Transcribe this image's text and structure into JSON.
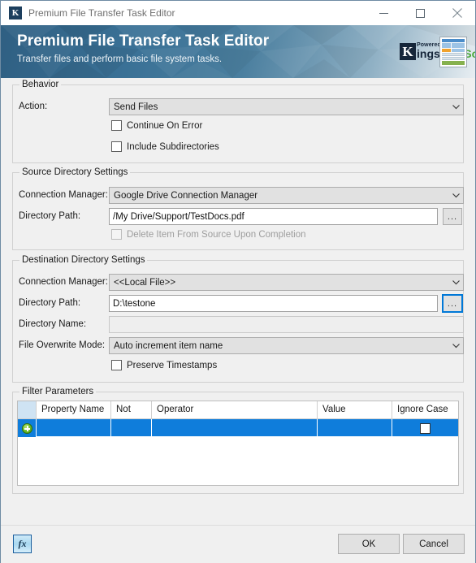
{
  "window": {
    "title": "Premium File Transfer Task Editor",
    "icon": "kingswaysoft-k-icon",
    "controls": {
      "minimize": "minimize-icon",
      "maximize": "maximize-icon",
      "close": "close-icon"
    }
  },
  "banner": {
    "title": "Premium File Transfer Task Editor",
    "subtitle": "Transfer files and perform basic file system tasks.",
    "logo": {
      "letter": "K",
      "powered_by": "Powered By",
      "name_part1": "ingsway",
      "name_part2": "Soft"
    },
    "doc_icon": "document-preview-icon",
    "accent_color": "#3a7196",
    "brand_green": "#4ca93c",
    "brand_navy": "#16263a"
  },
  "behavior": {
    "group_title": "Behavior",
    "action_label": "Action:",
    "action_value": "Send Files",
    "continue_on_error": {
      "label": "Continue On Error",
      "checked": false
    },
    "include_subdirectories": {
      "label": "Include Subdirectories",
      "checked": false
    }
  },
  "source": {
    "group_title": "Source Directory Settings",
    "connection_manager_label": "Connection Manager:",
    "connection_manager_value": "Google Drive Connection Manager",
    "directory_path_label": "Directory Path:",
    "directory_path_value": "/My Drive/Support/TestDocs.pdf",
    "browse_label": "...",
    "delete_item": {
      "label": "Delete Item From Source Upon Completion",
      "checked": false,
      "disabled": true
    }
  },
  "destination": {
    "group_title": "Destination Directory Settings",
    "connection_manager_label": "Connection Manager:",
    "connection_manager_value": "<<Local File>>",
    "directory_path_label": "Directory Path:",
    "directory_path_value": "D:\\testone",
    "browse_label": "...",
    "directory_name_label": "Directory Name:",
    "directory_name_value": "",
    "file_overwrite_label": "File Overwrite Mode:",
    "file_overwrite_value": "Auto increment item name",
    "preserve_timestamps": {
      "label": "Preserve Timestamps",
      "checked": false
    }
  },
  "filter": {
    "group_title": "Filter Parameters",
    "columns": [
      "Property Name",
      "Not",
      "Operator",
      "Value",
      "Ignore Case"
    ],
    "new_row_icon": "add-row-plus-icon",
    "rows": [
      {
        "property_name": "",
        "not": "",
        "operator": "",
        "value": "",
        "ignore_case": false
      }
    ],
    "selection_color": "#0f7ddb",
    "header_corner_color": "#cfe3f3"
  },
  "footer": {
    "expression_button": "fx",
    "ok_label": "OK",
    "cancel_label": "Cancel"
  }
}
